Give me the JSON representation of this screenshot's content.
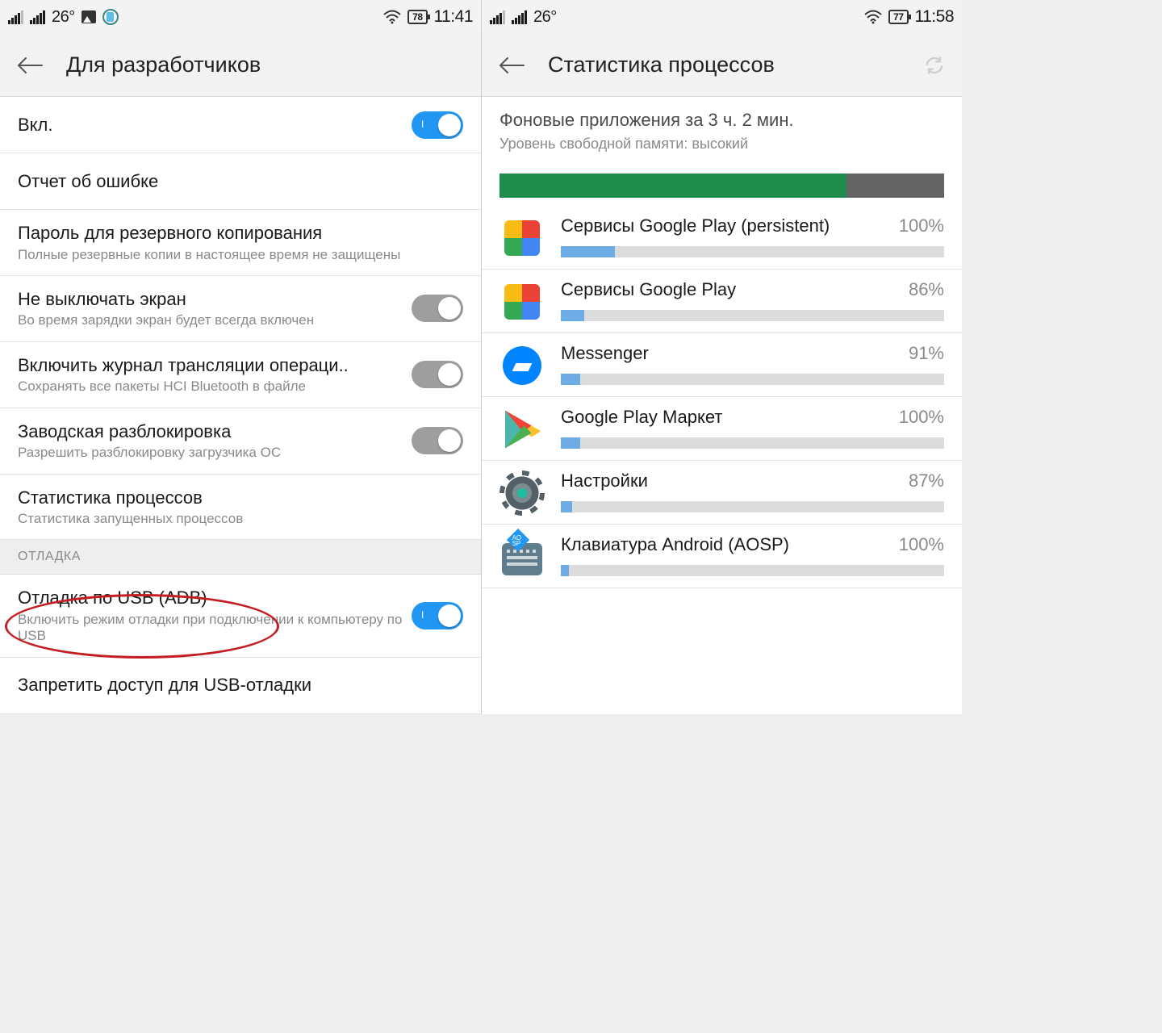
{
  "left": {
    "status": {
      "temp": "26°",
      "battery": "78",
      "clock": "11:41"
    },
    "title": "Для разработчиков",
    "items": [
      {
        "title": "Вкл.",
        "sub": "",
        "toggle": "on"
      },
      {
        "title": "Отчет об ошибке",
        "sub": "",
        "toggle": ""
      },
      {
        "title": "Пароль для резервного копирования",
        "sub": "Полные резервные копии в настоящее время не защищены",
        "toggle": ""
      },
      {
        "title": "Не выключать экран",
        "sub": "Во время зарядки экран будет всегда включен",
        "toggle": "off"
      },
      {
        "title": "Включить журнал трансляции операци..",
        "sub": "Сохранять все пакеты HCI Bluetooth в файле",
        "toggle": "off"
      },
      {
        "title": "Заводская разблокировка",
        "sub": "Разрешить разблокировку загрузчика ОС",
        "toggle": "off"
      },
      {
        "title": "Статистика процессов",
        "sub": "Статистика запущенных процессов",
        "toggle": ""
      }
    ],
    "section_header": "ОТЛАДКА",
    "items2": [
      {
        "title": "Отладка по USB (ADB)",
        "sub": "Включить режим отладки при подключении к компьютеру по USB",
        "toggle": "on"
      },
      {
        "title": "Запретить доступ для USB-отладки",
        "sub": "",
        "toggle": ""
      }
    ]
  },
  "right": {
    "status": {
      "temp": "26°",
      "battery": "77",
      "clock": "11:58"
    },
    "title": "Статистика процессов",
    "meta_title": "Фоновые приложения за 3 ч. 2 мин.",
    "meta_sub": "Уровень свободной памяти: высокий",
    "mem_used_pct": 78,
    "procs": [
      {
        "name": "Сервисы Google Play (persistent)",
        "pct": 100,
        "bar": 14,
        "icon": "gplay-services"
      },
      {
        "name": "Сервисы Google Play",
        "pct": 86,
        "bar": 6,
        "icon": "gplay-services"
      },
      {
        "name": "Messenger",
        "pct": 91,
        "bar": 5,
        "icon": "messenger"
      },
      {
        "name": "Google Play Маркет",
        "pct": 100,
        "bar": 5,
        "icon": "playstore"
      },
      {
        "name": "Настройки",
        "pct": 87,
        "bar": 3,
        "icon": "settings"
      },
      {
        "name": "Клавиатура Android (AOSP)",
        "pct": 100,
        "bar": 2,
        "icon": "keyboard"
      }
    ]
  },
  "chart_data": [
    {
      "type": "bar",
      "title": "Уровень свободной памяти",
      "categories": [
        "used",
        "free"
      ],
      "values": [
        78,
        22
      ],
      "ylim": [
        0,
        100
      ]
    },
    {
      "type": "bar",
      "title": "Статистика процессов — % времени",
      "categories": [
        "Сервисы Google Play (persistent)",
        "Сервисы Google Play",
        "Messenger",
        "Google Play Маркет",
        "Настройки",
        "Клавиатура Android (AOSP)"
      ],
      "values": [
        100,
        86,
        91,
        100,
        87,
        100
      ],
      "ylabel": "%",
      "ylim": [
        0,
        100
      ]
    }
  ]
}
